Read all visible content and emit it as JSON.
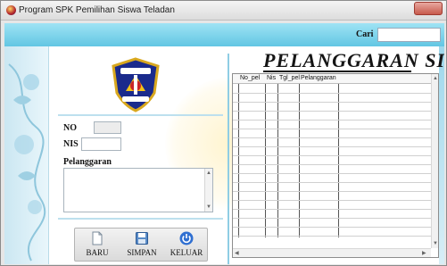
{
  "window": {
    "title": "Program SPK Pemilihan Siswa Teladan"
  },
  "search": {
    "label": "Cari",
    "value": ""
  },
  "form": {
    "no_label": "NO",
    "no_value": "",
    "nis_label": "NIS",
    "nis_value": "",
    "pelanggaran_label": "Pelanggaran",
    "pelanggaran_value": ""
  },
  "buttons": {
    "baru": "BARU",
    "simpan": "SIMPAN",
    "keluar": "KELUAR"
  },
  "panel": {
    "heading": "PELANGGARAN SISWA"
  },
  "grid": {
    "columns": [
      "No_pel",
      "Nis",
      "Tgl_pel",
      "Pelanggaran"
    ],
    "rows": []
  },
  "icons": {
    "app": "app-logo-icon",
    "baru": "new-document-icon",
    "simpan": "save-disk-icon",
    "keluar": "power-icon"
  },
  "colors": {
    "topbar": "#62c6e3",
    "accent_line": "#8fcde4",
    "close": "#c75a4c"
  }
}
